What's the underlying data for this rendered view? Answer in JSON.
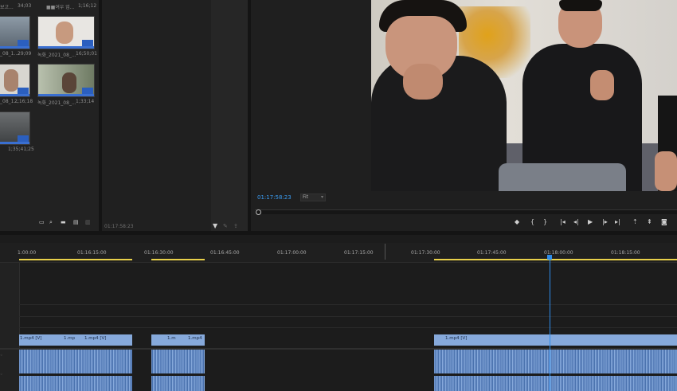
{
  "project_panel": {
    "items": [
      {
        "name": "보고...",
        "duration": "34;03"
      },
      {
        "name": "■■여우 업...",
        "duration": "1;16;12"
      },
      {
        "name": "_08_1...",
        "duration": "29;09"
      },
      {
        "name": "녹화_2021_08_...",
        "duration": "16;50;01"
      },
      {
        "name": "_08_1...",
        "duration": "2;16;18"
      },
      {
        "name": "녹화_2021_08_...",
        "duration": "1;33;14"
      },
      {
        "name": "",
        "duration": "1;35;41;25"
      }
    ]
  },
  "source_panel": {
    "timecode": "01:17:58:23"
  },
  "program_monitor": {
    "timecode": "01:17:58:23",
    "fit_label": "Fit",
    "controls": [
      "marker-icon",
      "mark-in-icon",
      "mark-out-icon",
      "go-to-in-icon",
      "step-back-icon",
      "play-icon",
      "step-forward-icon",
      "go-to-out-icon",
      "lift-icon",
      "extract-icon",
      "export-frame-icon"
    ]
  },
  "timeline": {
    "ruler": [
      "1:00:00",
      "01:16:15:00",
      "01:16:30:00",
      "01:16:45:00",
      "01:17:00:00",
      "01:17:15:00",
      "01:17:30:00",
      "01:17:45:00",
      "01:18:00:00",
      "01:18:15:00"
    ],
    "clip_labels": [
      "1.mp4 [V]",
      "1.mp",
      "1.mp4 [V]",
      "1.m",
      "1.mp4",
      "1.mp4 [V]"
    ]
  },
  "colors": {
    "accent_blue": "#2d8ceb",
    "clip_blue": "#86a9db",
    "work_area_yellow": "#e8d04a"
  }
}
